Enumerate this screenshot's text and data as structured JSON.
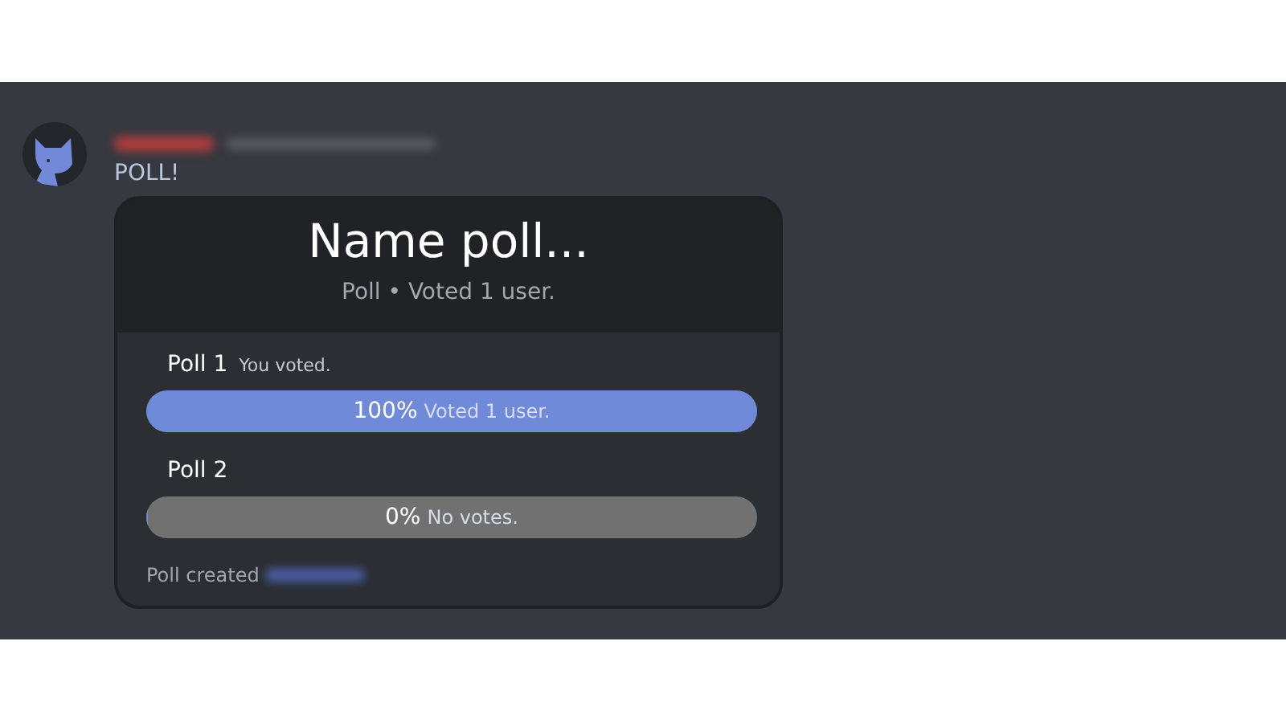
{
  "message": {
    "text": "POLL!"
  },
  "poll": {
    "title": "Name poll...",
    "subtitle": "Poll • Voted 1 user.",
    "options": [
      {
        "label": "Poll 1",
        "note": "You voted.",
        "level": 1,
        "percent": "100%",
        "votes": "Voted 1 user."
      },
      {
        "label": "Poll 2",
        "level": 0,
        "percent": "0%",
        "votes": "No votes."
      }
    ],
    "footer": "Poll created"
  }
}
